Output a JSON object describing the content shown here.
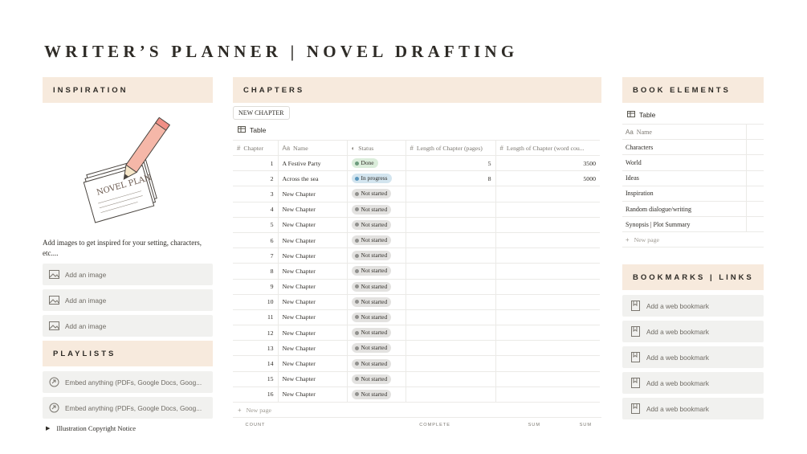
{
  "title": "WRITER’S PLANNER | NOVEL DRAFTING",
  "inspiration": {
    "heading": "INSPIRATION",
    "illustration_text": "NOVEL PLAN",
    "text": "Add images to get inspired for your setting, characters, etc....",
    "images": [
      "Add an image",
      "Add an image",
      "Add an image"
    ]
  },
  "playlists": {
    "heading": "PLAYLISTS",
    "embeds": [
      "Embed anything (PDFs, Google Docs, Goog...",
      "Embed anything (PDFs, Google Docs, Goog..."
    ]
  },
  "copyright_toggle": "Illustration Copyright Notice",
  "chapters": {
    "heading": "CHAPTERS",
    "new_button": "NEW CHAPTER",
    "view_label": "Table",
    "columns": [
      "Chapter",
      "Name",
      "Status",
      "Length of Chapter (pages)",
      "Length of Chapter (word cou..."
    ],
    "rows": [
      {
        "chapter": "1",
        "name": "A Festive Party",
        "status": "Done",
        "pages": "5",
        "words": "3500"
      },
      {
        "chapter": "2",
        "name": "Across the sea",
        "status": "In progress",
        "pages": "8",
        "words": "5000"
      },
      {
        "chapter": "3",
        "name": "New Chapter",
        "status": "Not started",
        "pages": "",
        "words": ""
      },
      {
        "chapter": "4",
        "name": "New Chapter",
        "status": "Not started",
        "pages": "",
        "words": ""
      },
      {
        "chapter": "5",
        "name": "New Chapter",
        "status": "Not started",
        "pages": "",
        "words": ""
      },
      {
        "chapter": "6",
        "name": "New Chapter",
        "status": "Not started",
        "pages": "",
        "words": ""
      },
      {
        "chapter": "7",
        "name": "New Chapter",
        "status": "Not started",
        "pages": "",
        "words": ""
      },
      {
        "chapter": "8",
        "name": "New Chapter",
        "status": "Not started",
        "pages": "",
        "words": ""
      },
      {
        "chapter": "9",
        "name": "New Chapter",
        "status": "Not started",
        "pages": "",
        "words": ""
      },
      {
        "chapter": "10",
        "name": "New Chapter",
        "status": "Not started",
        "pages": "",
        "words": ""
      },
      {
        "chapter": "11",
        "name": "New Chapter",
        "status": "Not started",
        "pages": "",
        "words": ""
      },
      {
        "chapter": "12",
        "name": "New Chapter",
        "status": "Not started",
        "pages": "",
        "words": ""
      },
      {
        "chapter": "13",
        "name": "New Chapter",
        "status": "Not started",
        "pages": "",
        "words": ""
      },
      {
        "chapter": "14",
        "name": "New Chapter",
        "status": "Not started",
        "pages": "",
        "words": ""
      },
      {
        "chapter": "15",
        "name": "New Chapter",
        "status": "Not started",
        "pages": "",
        "words": ""
      },
      {
        "chapter": "16",
        "name": "New Chapter",
        "status": "Not started",
        "pages": "",
        "words": ""
      }
    ],
    "new_page": "New page",
    "calc": [
      "COUNT",
      "COMPLETE",
      "SUM",
      "SUM"
    ]
  },
  "status_colors": {
    "Done": {
      "bg": "#dbeddb",
      "dot": "#6c9b7d"
    },
    "In progress": {
      "bg": "#d3e5ef",
      "dot": "#5b97bd"
    },
    "Not started": {
      "bg": "#e3e2e0",
      "dot": "#91918e"
    }
  },
  "book_elements": {
    "heading": "BOOK ELEMENTS",
    "view_label": "Table",
    "name_header": "Name",
    "items": [
      "Characters",
      "World",
      "Ideas",
      "Inspiration",
      "Random dialogue/writing",
      "Synopsis | Plot Summary"
    ],
    "new_page": "New page"
  },
  "bookmarks": {
    "heading": "BOOKMARKS | LINKS",
    "items": [
      "Add a web bookmark",
      "Add a web bookmark",
      "Add a web bookmark",
      "Add a web bookmark",
      "Add a web bookmark"
    ]
  }
}
